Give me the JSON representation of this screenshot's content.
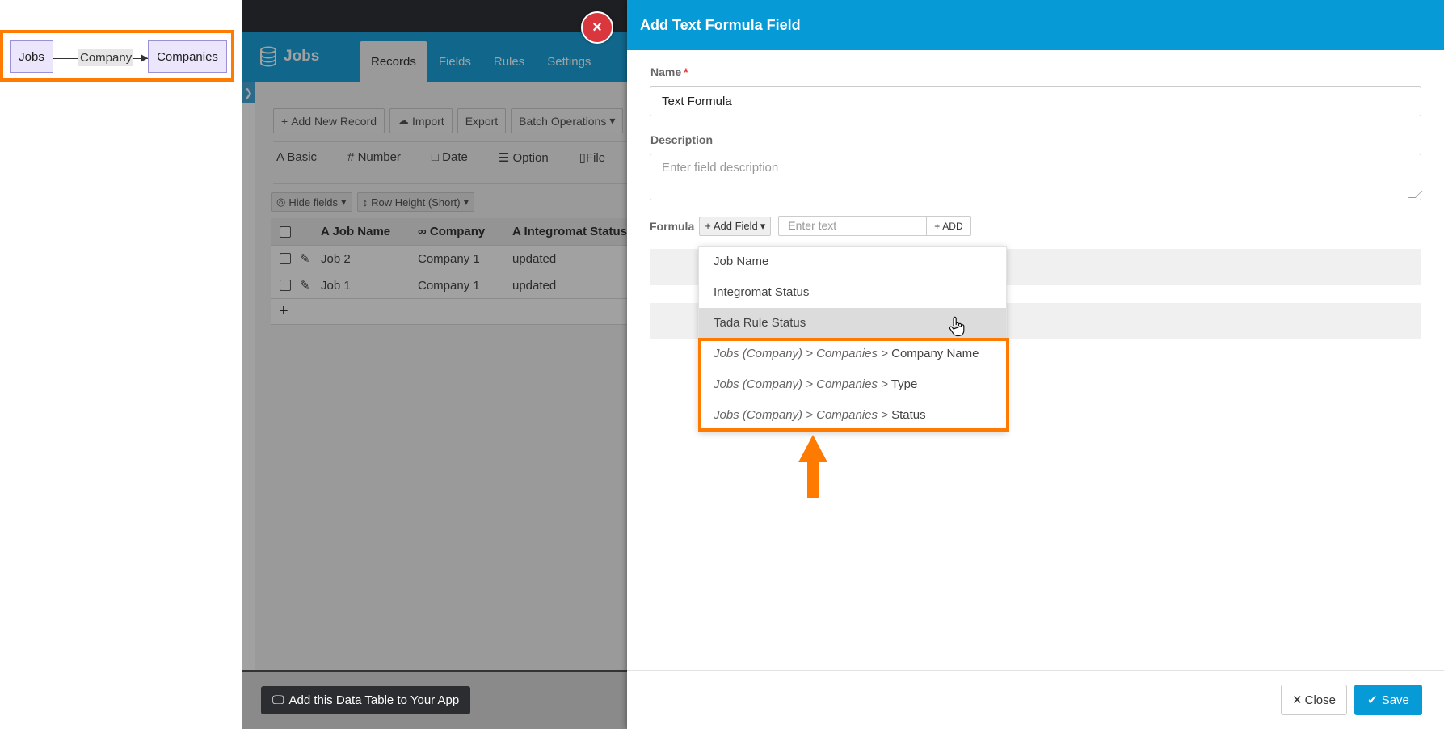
{
  "diagram": {
    "source_node": "Jobs",
    "edge_label": "Company",
    "target_node": "Companies"
  },
  "app": {
    "title": "Jobs",
    "tabs": [
      {
        "label": "Records",
        "active": true
      },
      {
        "label": "Fields",
        "active": false
      },
      {
        "label": "Rules",
        "active": false
      },
      {
        "label": "Settings",
        "active": false
      }
    ],
    "toolbar": {
      "add_new_record": "Add New Record",
      "import": "Import",
      "export": "Export",
      "batch_operations": "Batch Operations"
    },
    "field_types": [
      "Basic",
      "Number",
      "Date",
      "Option",
      "File"
    ],
    "view_controls": {
      "hide_fields": "Hide fields",
      "row_height": "Row Height (Short)"
    },
    "table": {
      "columns": [
        "Job Name",
        "Company",
        "Integromat Status"
      ],
      "rows": [
        {
          "job_name": "Job 2",
          "company": "Company 1",
          "status": "updated"
        },
        {
          "job_name": "Job 1",
          "company": "Company 1",
          "status": "updated"
        }
      ],
      "add_row": "+"
    },
    "footer_button": "Add this Data Table to Your App"
  },
  "close_icon_glyph": "×",
  "panel": {
    "title": "Add Text Formula Field",
    "name_label": "Name",
    "required_mark": "*",
    "name_value": "Text Formula",
    "description_label": "Description",
    "description_placeholder": "Enter field description",
    "formula_label": "Formula",
    "add_field_button": "Add Field",
    "formula_input_placeholder": "Enter text",
    "formula_add_button": "ADD",
    "dropdown_items": [
      {
        "prefix": "",
        "label": "Job Name"
      },
      {
        "prefix": "",
        "label": "Integromat Status"
      },
      {
        "prefix": "",
        "label": "Tada Rule Status"
      },
      {
        "prefix": "Jobs (Company) > Companies >",
        "label": "Company Name"
      },
      {
        "prefix": "Jobs (Company) > Companies >",
        "label": "Type"
      },
      {
        "prefix": "Jobs (Company) > Companies >",
        "label": "Status"
      }
    ],
    "hovered_item_index": 2,
    "close_button": "Close",
    "save_button": "Save"
  },
  "colors": {
    "header_blue": "#069ad6",
    "highlight_orange": "#ff7a00",
    "close_red": "#d9363e"
  }
}
